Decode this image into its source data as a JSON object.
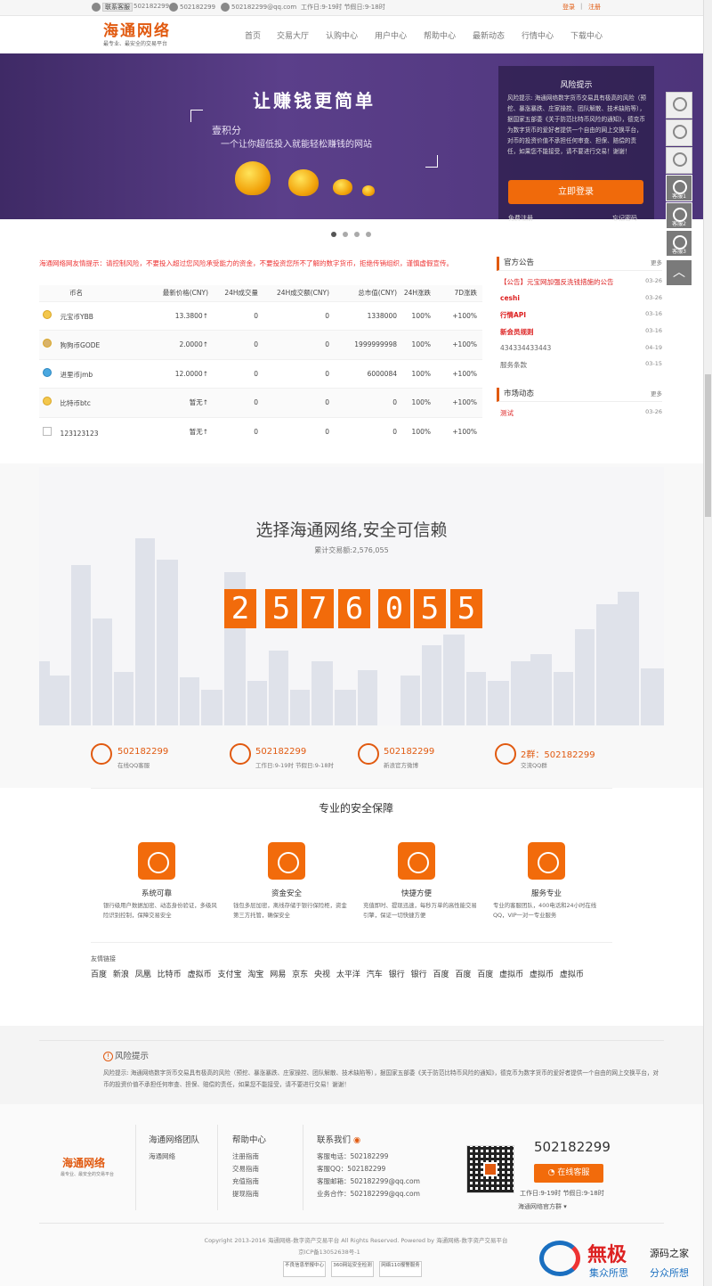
{
  "topbar": {
    "service_tag": "联系客服",
    "qq1": "502182299",
    "phone": "502182299",
    "email": "502182299@qq.com",
    "hours": "工作日:9-19时 节假日:9-18时",
    "login": "登录",
    "register": "注册"
  },
  "brand": {
    "name": "海通网络",
    "slogan": "最专业、最安全的交易平台",
    "color": "#e15a10"
  },
  "nav": [
    "首页",
    "交易大厅",
    "认购中心",
    "用户中心",
    "帮助中心",
    "最新动态",
    "行情中心",
    "下载中心"
  ],
  "banner": {
    "title": "让赚钱更简单",
    "sub1": "壹积分",
    "sub2": "一个让你超低投入就能轻松赚钱的网站"
  },
  "risk_panel": {
    "title": "风险提示",
    "text": "风险提示: 海通网络数字货币交易具有极高的风险（预挖、暴涨暴跌、庄家操控、团队解散、技术缺陷等），据国家五部委《关于防范比特币风险的通知》，德克币为数字货币的爱好者提供一个自由的网上交换平台，对币的投资价值不承担任何审查、担保、赔偿的责任，如果您不能接受，请不要进行交易！谢谢！",
    "login_button": "立即登录",
    "link_register": "免费注册",
    "link_forgot": "忘记密码"
  },
  "notice": "海通网络网友情提示：请控制风险，不要投入超过您风险承受能力的资金，不要投资您所不了解的数字货币，拒绝传销组织，谨慎虚假宣传。",
  "market": {
    "headers": [
      "币名",
      "最新价格(CNY)",
      "24H成交量",
      "24H成交额(CNY)",
      "总市值(CNY)",
      "24H涨跌",
      "7D涨跌"
    ],
    "rows": [
      {
        "name": "元宝币YBB",
        "price": "13.3800↑",
        "vol": "0",
        "amt": "0",
        "cap": "1338000",
        "d1": "100%",
        "d7": "+100%"
      },
      {
        "name": "狗狗币GODE",
        "price": "2.0000↑",
        "vol": "0",
        "amt": "0",
        "cap": "1999999998",
        "d1": "100%",
        "d7": "+100%"
      },
      {
        "name": "进里币jmb",
        "price": "12.0000↑",
        "vol": "0",
        "amt": "0",
        "cap": "6000084",
        "d1": "100%",
        "d7": "+100%"
      },
      {
        "name": "比特币btc",
        "price": "暂无↑",
        "vol": "0",
        "amt": "0",
        "cap": "0",
        "d1": "100%",
        "d7": "+100%"
      },
      {
        "name": "123123123",
        "price": "暂无↑",
        "vol": "0",
        "amt": "0",
        "cap": "0",
        "d1": "100%",
        "d7": "+100%"
      }
    ]
  },
  "announcements": {
    "title": "官方公告",
    "more": "更多",
    "items": [
      {
        "text": "【公告】元宝网加强反洗钱措施的公告",
        "date": "03-26",
        "style": "red"
      },
      {
        "text": "ceshi",
        "date": "03-26",
        "style": "red"
      },
      {
        "text": "行情API",
        "date": "03-16",
        "style": "red"
      },
      {
        "text": "新会员规则",
        "date": "03-16",
        "style": "red"
      },
      {
        "text": "434334433443",
        "date": "04-19",
        "style": "gray"
      },
      {
        "text": "服务条款",
        "date": "03-15",
        "style": "gray"
      }
    ]
  },
  "market_news": {
    "title": "市场动态",
    "more": "更多",
    "items": [
      {
        "text": "测试",
        "date": "03-26"
      }
    ]
  },
  "trust": {
    "title": "选择海通网络,安全可信赖",
    "subtitle": "累计交易额:2,576,055",
    "digits": [
      "2",
      "5",
      "7",
      "6",
      "0",
      "5",
      "5"
    ]
  },
  "contacts": [
    {
      "value": "502182299",
      "sub": "在线QQ客服",
      "icon": "qq-icon"
    },
    {
      "value": "502182299",
      "sub": "工作日:9-19时 节假日:9-18时",
      "icon": "phone-icon"
    },
    {
      "value": "502182299",
      "sub": "新浪官方微博",
      "icon": "weibo-icon"
    },
    {
      "value": "2群：502182299",
      "sub": "交流QQ群",
      "icon": "group-icon"
    }
  ],
  "security": {
    "title": "专业的安全保障",
    "features": [
      {
        "title": "系统可靠",
        "desc": "银行级用户数据加密、动态身份验证，多级风险识别控制，保障交易安全"
      },
      {
        "title": "资金安全",
        "desc": "钱包多层加密，离线存储于银行保险柜，资金第三方托管，确保安全"
      },
      {
        "title": "快捷方便",
        "desc": "充值即时、提现迅速，每秒万单的高性能交易引擎，保证一切快捷方便"
      },
      {
        "title": "服务专业",
        "desc": "专业的客服团队，400电话和24小时在线QQ，VIP一对一专业服务"
      }
    ]
  },
  "friend_links": {
    "title": "友情链接",
    "items": [
      "百度",
      "新浪",
      "凤凰",
      "比特币",
      "虚拟币",
      "支付宝",
      "淘宝",
      "网易",
      "京东",
      "央视",
      "太平洋",
      "汽车",
      "银行",
      "银行",
      "百度",
      "百度",
      "百度",
      "虚拟币",
      "虚拟币",
      "虚拟币"
    ]
  },
  "risk_footer": {
    "title": "风险提示",
    "text": "风险提示: 海通网络数字货币交易具有极高的风险（预挖、暴涨暴跌、庄家操控、团队解散、技术缺陷等），据国家五部委《关于防范比特币风险的通知》，德克币为数字货币的爱好者提供一个自由的网上交换平台，对币的投资价值不承担任何审查、担保、赔偿的责任，如果您不能接受，请不要进行交易！谢谢！"
  },
  "footer": {
    "col1_title": "海通网络团队",
    "col1_items": [
      "海通网络"
    ],
    "col2_title": "帮助中心",
    "col2_items": [
      "注册指南",
      "交易指南",
      "充值指南",
      "提现指南"
    ],
    "col3_title": "联系我们",
    "col3_items": [
      "客服电话：502182299",
      "客服QQ：502182299",
      "客服邮箱：502182299@qq.com",
      "业务合作：502182299@qq.com"
    ],
    "phone": "502182299",
    "online_button": "在线客服",
    "hours": "工作日:9-19时 节假日:9-18时",
    "group": "海通网络官方群",
    "copyright": "Copyright 2013-2016 海通网络-数字资产交易平台 All Rights Reserved. Powered by 海通网络-数字资产交易平台",
    "icp": "京ICP备13052638号-1",
    "badges": [
      "不良信息举报中心",
      "360网站安全检测",
      "网络110报警服务"
    ]
  },
  "side_tools": [
    "客服1",
    "客服2",
    "客服3"
  ],
  "watermark": {
    "logo": "無极",
    "t1": "源码之家",
    "t2": "集众所思",
    "t3": "分众所想"
  }
}
